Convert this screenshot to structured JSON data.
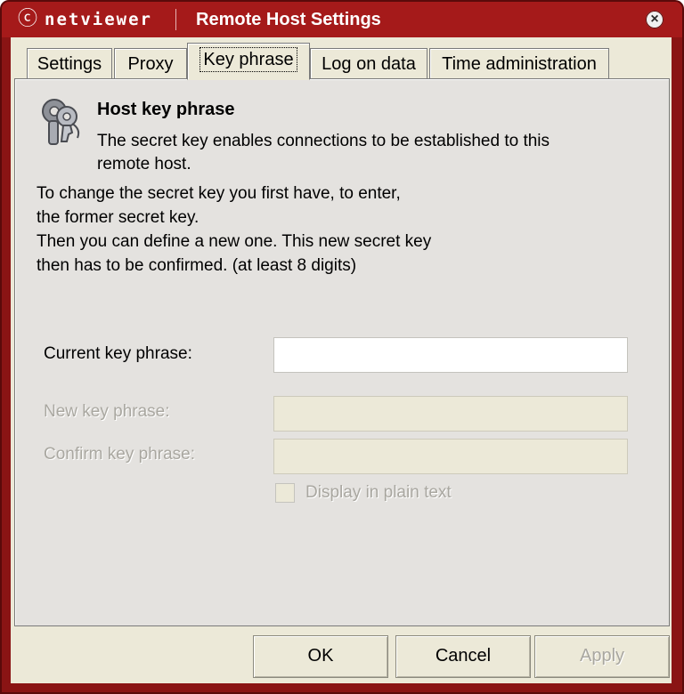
{
  "window": {
    "brand": "netviewer",
    "title": "Remote Host Settings",
    "close_icon": "close-icon"
  },
  "tabs": [
    {
      "label": "Settings",
      "active": false
    },
    {
      "label": "Proxy",
      "active": false
    },
    {
      "label": "Key phrase",
      "active": true
    },
    {
      "label": "Log on data",
      "active": false
    },
    {
      "label": "Time administration",
      "active": false
    }
  ],
  "section": {
    "icon": "keys-icon",
    "title": "Host key phrase",
    "description": "The secret key enables connections to be established to this remote host."
  },
  "instructions": [
    "To change the secret key you first have, to enter,",
    "the former secret key.",
    "Then you can define a new one. This new secret key",
    "then has to be confirmed. (at least 8 digits)"
  ],
  "fields": {
    "current": {
      "label": "Current key phrase:",
      "value": "",
      "enabled": true
    },
    "new": {
      "label": "New key phrase:",
      "value": "",
      "enabled": false
    },
    "confirm": {
      "label": "Confirm key phrase:",
      "value": "",
      "enabled": false
    }
  },
  "display_plain": {
    "label": "Display in plain text",
    "checked": false,
    "enabled": false
  },
  "buttons": {
    "ok": "OK",
    "cancel": "Cancel",
    "apply": "Apply"
  },
  "colors": {
    "title_bar": "#a51a1a",
    "frame": "#8a1414",
    "panel": "#e4e2df"
  }
}
